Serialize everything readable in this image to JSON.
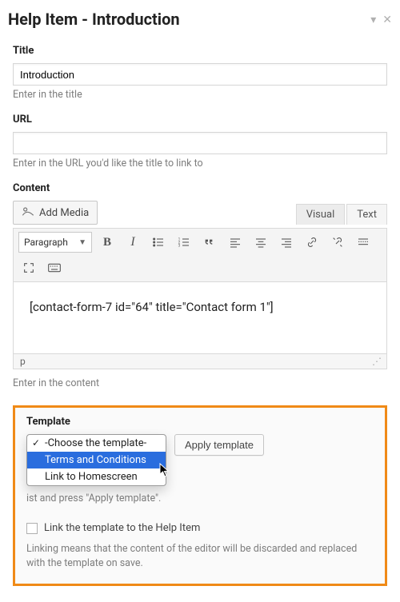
{
  "panel": {
    "title": "Help Item - Introduction"
  },
  "fields": {
    "title_label": "Title",
    "title_value": "Introduction",
    "title_hint": "Enter in the title",
    "url_label": "URL",
    "url_value": "",
    "url_hint": "Enter in the URL you'd like the title to link to",
    "content_label": "Content",
    "content_hint": "Enter in the content"
  },
  "editor": {
    "add_media": "Add Media",
    "tabs": {
      "visual": "Visual",
      "text": "Text"
    },
    "format": "Paragraph",
    "body": "[contact-form-7 id=\"64\" title=\"Contact form 1\"]",
    "path": "p"
  },
  "template": {
    "label": "Template",
    "options": [
      "-Choose the template-",
      "Terms and Conditions",
      "Link to Homescreen"
    ],
    "highlighted_index": 1,
    "apply": "Apply template",
    "hint_suffix": "ist and press \"Apply template\".",
    "checkbox_label": "Link the template to the Help Item",
    "linking_note": "Linking means that the content of the editor will be discarded and replaced with the template on save."
  }
}
